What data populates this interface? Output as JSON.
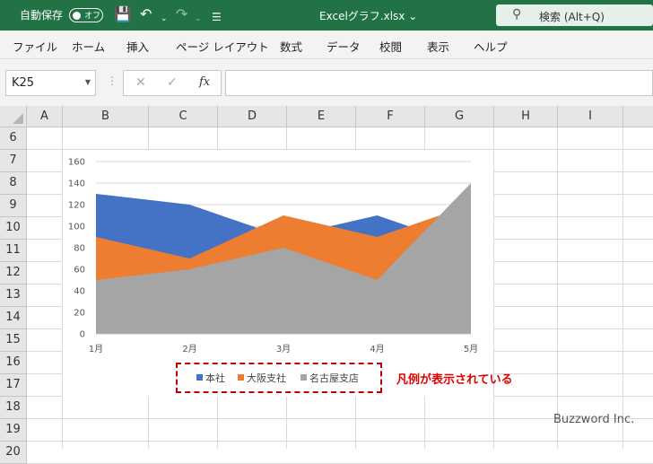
{
  "titlebar": {
    "autosave_label": "自動保存",
    "autosave_state": "オフ",
    "filename": "Excelグラフ.xlsx",
    "filename_caret": "⌄",
    "search_label": "検索 (Alt+Q)"
  },
  "menu": [
    "ファイル",
    "ホーム",
    "挿入",
    "ページ レイアウト",
    "数式",
    "データ",
    "校閲",
    "表示",
    "ヘルプ"
  ],
  "formula_bar": {
    "name_box": "K25",
    "cancel": "✕",
    "enter": "✓",
    "fx": "fx",
    "value": ""
  },
  "columns": [
    "A",
    "B",
    "C",
    "D",
    "E",
    "F",
    "G",
    "H",
    "I"
  ],
  "rows": [
    "6",
    "7",
    "8",
    "9",
    "10",
    "11",
    "12",
    "13",
    "14",
    "15",
    "16",
    "17",
    "18",
    "19",
    "20"
  ],
  "chart_data": {
    "type": "area",
    "categories": [
      "1月",
      "2月",
      "3月",
      "4月",
      "5月"
    ],
    "ylim": [
      0,
      160
    ],
    "yticks": [
      "0",
      "20",
      "40",
      "60",
      "80",
      "100",
      "120",
      "140",
      "160"
    ],
    "series": [
      {
        "name": "本社",
        "values": [
          130,
          120,
          90,
          110,
          80
        ],
        "color": "#4472c4"
      },
      {
        "name": "大阪支社",
        "values": [
          90,
          70,
          110,
          90,
          120
        ],
        "color": "#ed7d31"
      },
      {
        "name": "名古屋支店",
        "values": [
          50,
          60,
          80,
          50,
          140
        ],
        "color": "#a5a5a5"
      }
    ],
    "legend_position": "bottom",
    "grid": true
  },
  "annotation": "凡例が表示されている",
  "watermark": "Buzzword Inc."
}
